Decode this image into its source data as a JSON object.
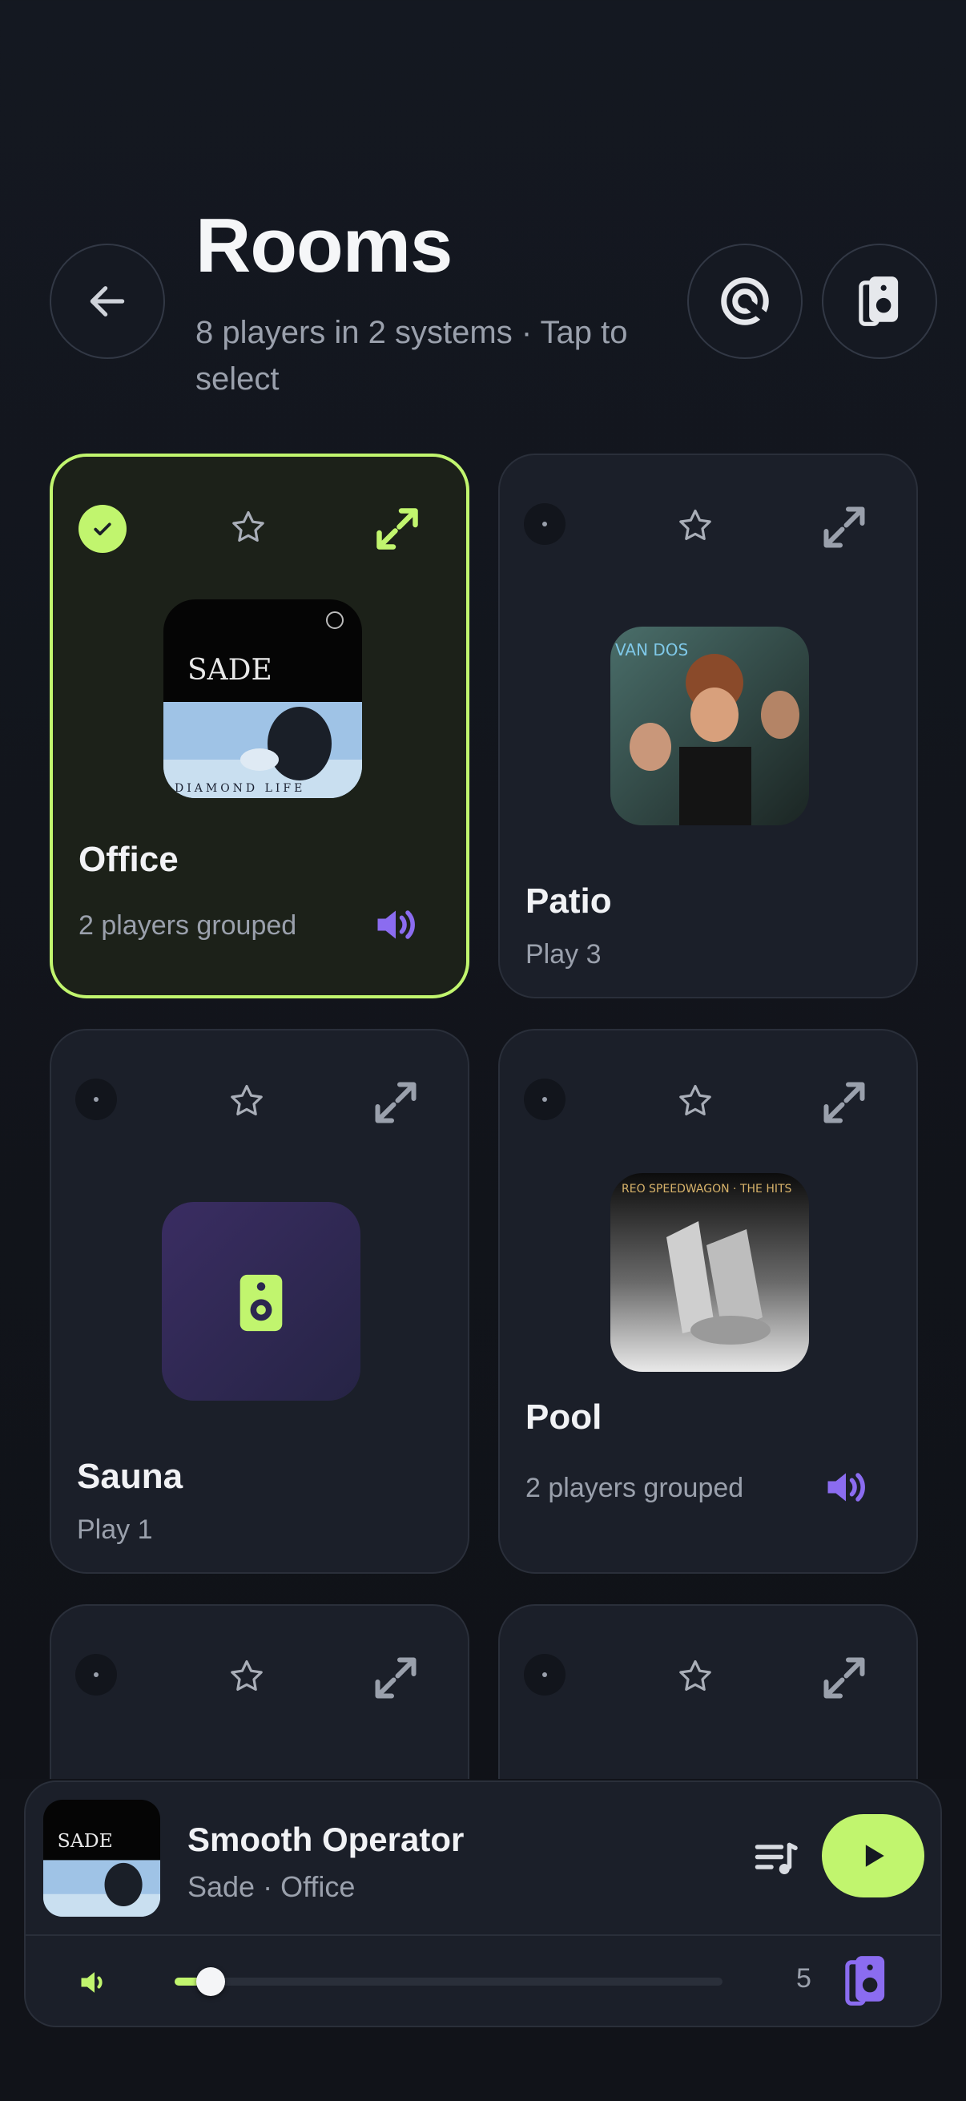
{
  "header": {
    "title": "Rooms",
    "subtitle": "8 players in 2 systems · Tap to select",
    "back_icon": "arrow-left-icon",
    "cast_icon": "cast-target-icon",
    "speaker_icon": "speaker-icon"
  },
  "rooms": [
    {
      "name": "Office",
      "sub": "2 players grouped",
      "selected": true,
      "playing": true,
      "art": "sade-diamond-life"
    },
    {
      "name": "Patio",
      "sub": "Play 3",
      "selected": false,
      "playing": false,
      "art": "van-dos-album"
    },
    {
      "name": "Sauna",
      "sub": "Play 1",
      "selected": false,
      "playing": false,
      "art": "speaker-placeholder"
    },
    {
      "name": "Pool",
      "sub": "2 players grouped",
      "selected": false,
      "playing": true,
      "art": "reo-speedwagon-hits"
    }
  ],
  "album_text": {
    "sade": "SADE",
    "diamond_life": "DIAMOND LIFE",
    "van_dos": "VAN DOS",
    "reo": "REO SPEEDWAGON · THE HITS"
  },
  "now_playing": {
    "title": "Smooth Operator",
    "subtitle": "Sade · Office",
    "volume_fraction": 0.04,
    "speaker_count": "5"
  },
  "colors": {
    "accent": "#c1f56e",
    "purple": "#8b6cf0",
    "card": "#1b1f29"
  }
}
